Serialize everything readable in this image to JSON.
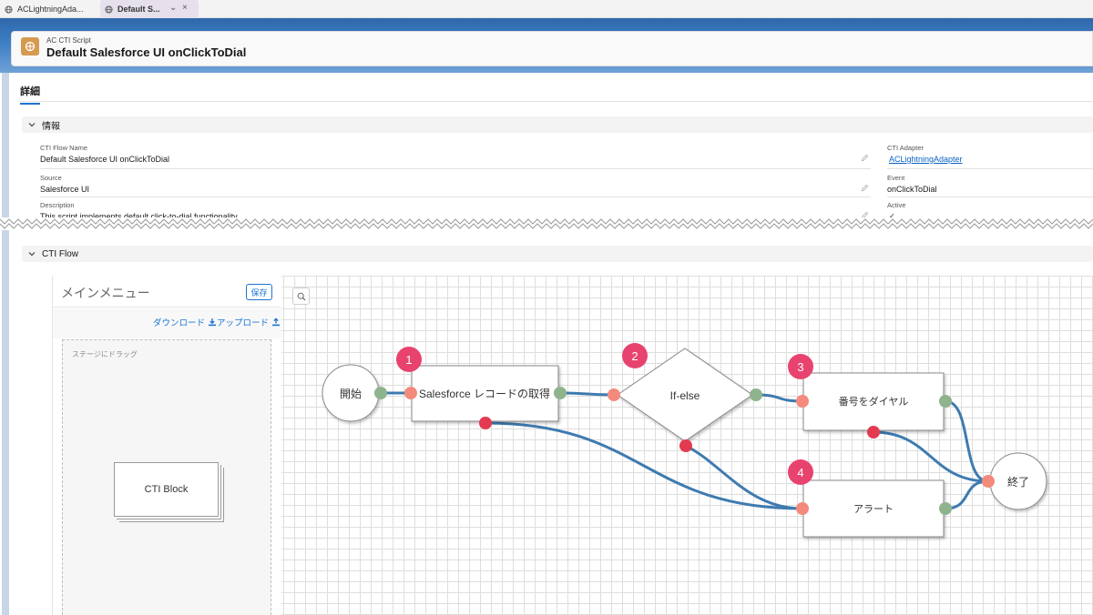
{
  "tabs": [
    {
      "label": "ACLightningAda..."
    },
    {
      "label": "Default S..."
    }
  ],
  "header": {
    "type_label": "AC CTI Script",
    "title": "Default Salesforce UI onClickToDial"
  },
  "detail_tab": "詳細",
  "info_section": {
    "title": "情報",
    "fields_left": [
      {
        "label": "CTI Flow Name",
        "value": "Default Salesforce UI onClickToDial"
      },
      {
        "label": "Source",
        "value": "Salesforce UI"
      },
      {
        "label": "Description",
        "value": "This script implements default click-to-dial functionality."
      }
    ],
    "fields_right": [
      {
        "label": "CTI Adapter",
        "value": "ACLightningAdapter"
      },
      {
        "label": "Event",
        "value": "onClickToDial"
      },
      {
        "label": "Active",
        "value": "✓"
      }
    ]
  },
  "flow_section": {
    "title": "CTI Flow",
    "palette": {
      "title": "メインメニュー",
      "save_label": "保存",
      "download_label": "ダウンロード",
      "upload_label": "アップロード",
      "drop_label": "ステージにドラッグ",
      "block_label": "CTI Block"
    },
    "nodes": {
      "start": "開始",
      "get_record": "Salesforce レコードの取得",
      "if_else": "If-else",
      "dial": "番号をダイヤル",
      "alert": "アラート",
      "end": "終了"
    },
    "badges": [
      "1",
      "2",
      "3",
      "4"
    ]
  },
  "colors": {
    "accent": "#1b74d2",
    "badge": "#e8436e",
    "connector": "#3f7bb0",
    "port_out": "#8fb38d",
    "port_in": "#f48a7c",
    "port_error": "#e33a52"
  }
}
